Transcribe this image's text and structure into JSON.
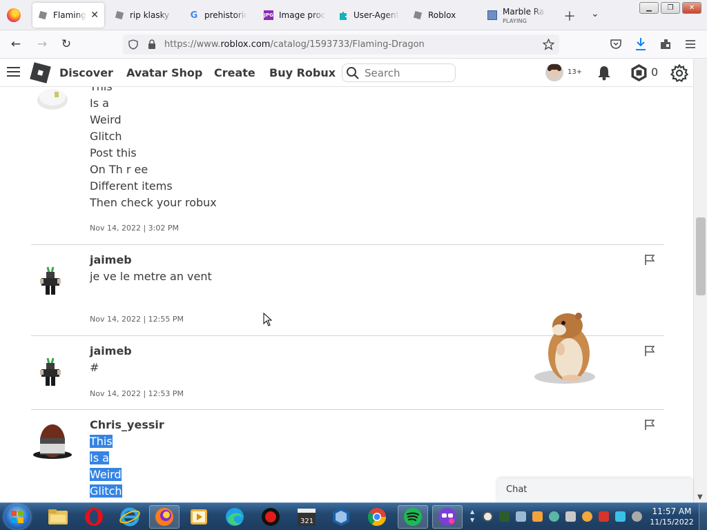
{
  "browser": {
    "tabs": [
      {
        "title": "Flaming Dragon - Roblox",
        "active": true
      },
      {
        "title": "rip klasky csupo"
      },
      {
        "title": "prehistoric dinosaur"
      },
      {
        "title": "Image processing"
      },
      {
        "title": "User-Agent Switcher"
      },
      {
        "title": "Roblox"
      },
      {
        "title": "Marble Race",
        "subtitle": "PLAYING"
      }
    ],
    "url_prefix": "https://www.",
    "url_domain": "roblox.com",
    "url_path": "/catalog/1593733/Flaming-Dragon"
  },
  "roblox": {
    "nav": [
      "Discover",
      "Avatar Shop",
      "Create",
      "Buy Robux"
    ],
    "search_placeholder": "Search",
    "age_tag": "13+",
    "robux": "0"
  },
  "comments": [
    {
      "author": "",
      "lines": [
        "This",
        "Is a",
        "Weird",
        "Glitch",
        "Post this",
        "On Th r ee",
        "Different items",
        "Then check your robux"
      ],
      "date": "Nov 14, 2022 | 3:02 PM"
    },
    {
      "author": "jaimeb",
      "lines": [
        "je ve le metre an vent"
      ],
      "date": "Nov 14, 2022 | 12:55 PM"
    },
    {
      "author": "jaimeb",
      "lines": [
        "#"
      ],
      "date": "Nov 14, 2022 | 12:53 PM"
    },
    {
      "author": "Chris_yessir",
      "lines": [
        "This",
        "Is a",
        "Weird",
        "Glitch"
      ],
      "date": ""
    }
  ],
  "chat": {
    "label": "Chat"
  },
  "taskbar": {
    "time": "11:57 AM",
    "date": "11/15/2022"
  },
  "colors": {
    "roblox_text": "#393b3d",
    "selection": "#3584e4"
  }
}
